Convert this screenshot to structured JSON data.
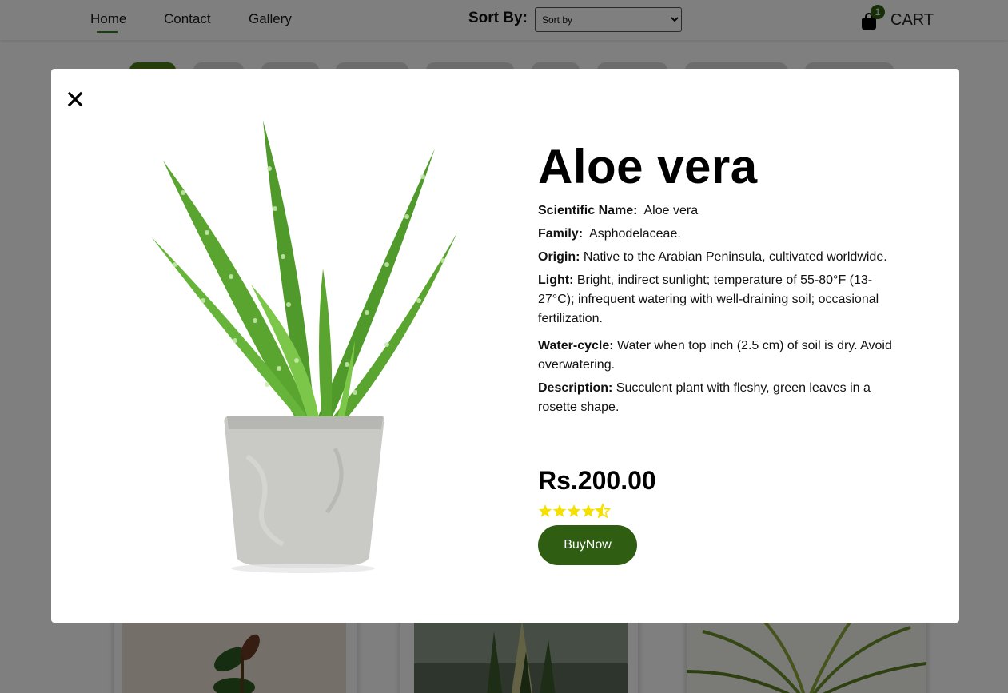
{
  "nav": {
    "home": "Home",
    "contact": "Contact",
    "gallery": "Gallery",
    "sort_label": "Sort By:",
    "sort_selected": "Sort by",
    "cart_label": "CART",
    "cart_count": "1"
  },
  "modal": {
    "title": "Aloe vera",
    "fields": {
      "scientific_label": "Scientific Name:",
      "scientific_value": "Aloe vera",
      "family_label": "Family:",
      "family_value": "Asphodelaceae.",
      "origin_label": "Origin:",
      "origin_value": "Native to the Arabian Peninsula, cultivated worldwide.",
      "light_label": "Light:",
      "light_value": "Bright, indirect sunlight; temperature of 55-80°F (13-27°C); infrequent watering with well-draining soil; occasional fertilization.",
      "water_label": "Water-cycle:",
      "water_value": "Water when top inch (2.5 cm) of soil is dry. Avoid overwatering.",
      "description_label": "Description:",
      "description_value": "Succulent plant with fleshy, green leaves in a rosette shape."
    },
    "price": "Rs.200.00",
    "rating": 4.5,
    "rating_max": 5,
    "buy_label": "BuyNow"
  },
  "colors": {
    "accent": "#2f5e12",
    "star": "#f5e000",
    "badge": "#2e5c10"
  },
  "icons": {
    "close": "close-icon",
    "cart": "shopping-bag-icon",
    "star": "star-icon"
  }
}
